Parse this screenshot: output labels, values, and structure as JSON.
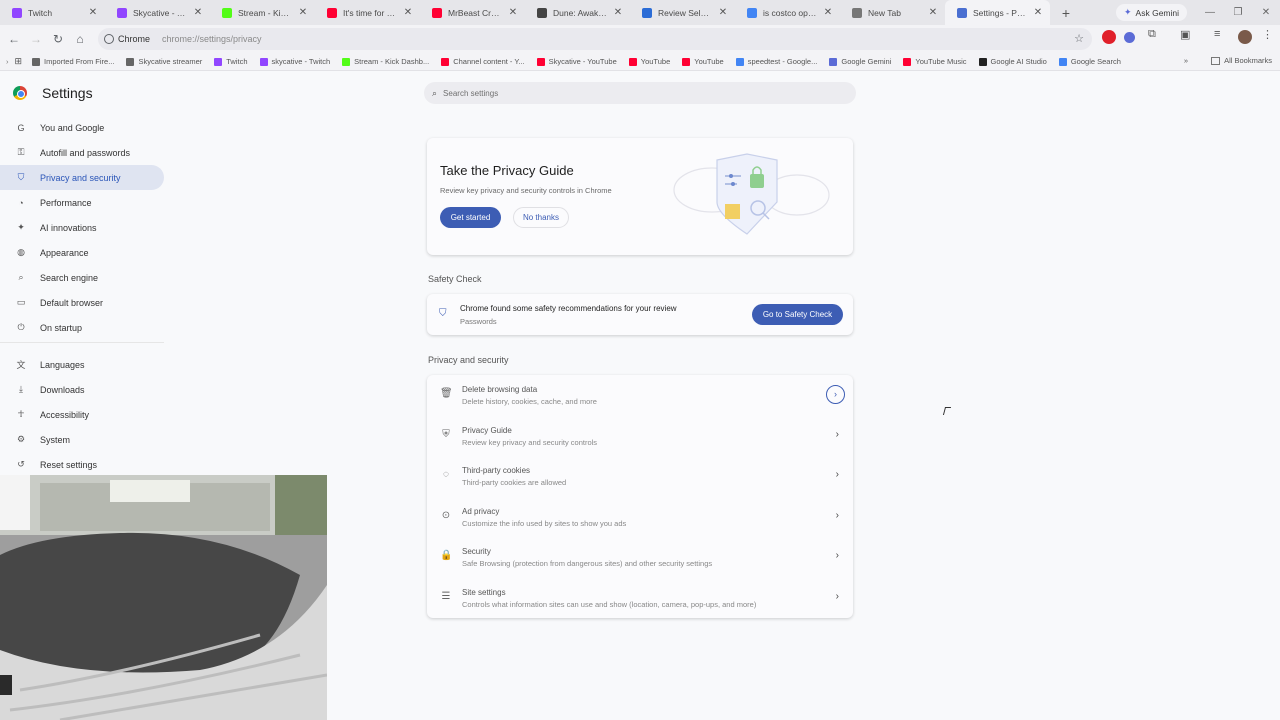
{
  "tabs": [
    {
      "title": "Twitch",
      "icon": "twitch-icon",
      "color": "#9146ff",
      "active": false
    },
    {
      "title": "Skycative - Twitch",
      "icon": "twitch-icon",
      "color": "#9146ff",
      "active": false
    },
    {
      "title": "Stream - Kick Das",
      "icon": "kick-icon",
      "color": "#53fc18",
      "active": false
    },
    {
      "title": "It's time for a big",
      "icon": "youtube-icon",
      "color": "#ff0033",
      "active": false
    },
    {
      "title": "MrBeast Crashout",
      "icon": "youtube-icon",
      "color": "#ff0033",
      "active": false
    },
    {
      "title": "Dune: Awakening",
      "icon": "game-icon",
      "color": "#444444",
      "active": false
    },
    {
      "title": "Review Selections",
      "icon": "doc-icon",
      "color": "#2b6cd6",
      "active": false
    },
    {
      "title": "is costco open on",
      "icon": "google-icon",
      "color": "#4285f4",
      "active": false
    },
    {
      "title": "New Tab",
      "icon": "chrome-icon",
      "color": "#777777",
      "active": false
    },
    {
      "title": "Settings - Privacy",
      "icon": "gear-icon",
      "color": "#4a6fd1",
      "active": true
    }
  ],
  "ask_gemini": "Ask Gemini",
  "omnibox": {
    "chip": "Chrome",
    "url": "chrome://settings/privacy"
  },
  "bookmarks": [
    {
      "label": "Imported From Fire...",
      "icon": "folder-icon",
      "color": "#666666"
    },
    {
      "label": "Skycative streamer",
      "icon": "stream-icon",
      "color": "#666666"
    },
    {
      "label": "Twitch",
      "icon": "twitch-icon",
      "color": "#9146ff"
    },
    {
      "label": "skycative - Twitch",
      "icon": "twitch-icon",
      "color": "#9146ff"
    },
    {
      "label": "Stream - Kick Dashb...",
      "icon": "kick-icon",
      "color": "#53fc18"
    },
    {
      "label": "Channel content - Y...",
      "icon": "youtube-icon",
      "color": "#ff0033"
    },
    {
      "label": "Skycative - YouTube",
      "icon": "youtube-icon",
      "color": "#ff0033"
    },
    {
      "label": "YouTube",
      "icon": "youtube-icon",
      "color": "#ff0033"
    },
    {
      "label": "YouTube",
      "icon": "youtube-icon",
      "color": "#ff0033"
    },
    {
      "label": "speedtest - Google...",
      "icon": "google-icon",
      "color": "#4285f4"
    },
    {
      "label": "Google Gemini",
      "icon": "gemini-icon",
      "color": "#5b6bd6"
    },
    {
      "label": "YouTube Music",
      "icon": "youtube-music-icon",
      "color": "#ff0033"
    },
    {
      "label": "Google AI Studio",
      "icon": "ai-studio-icon",
      "color": "#222222"
    },
    {
      "label": "Google Search",
      "icon": "google-icon",
      "color": "#4285f4"
    }
  ],
  "all_bookmarks": "All Bookmarks",
  "settings_title": "Settings",
  "search_placeholder": "Search settings",
  "nav": [
    {
      "label": "You and Google",
      "icon": "google-icon",
      "glyph": "G"
    },
    {
      "label": "Autofill and passwords",
      "icon": "key-icon",
      "glyph": "⚿"
    },
    {
      "label": "Privacy and security",
      "icon": "shield-icon",
      "glyph": "⛉",
      "active": true
    },
    {
      "label": "Performance",
      "icon": "speedometer-icon",
      "glyph": "◔"
    },
    {
      "label": "AI innovations",
      "icon": "sparkle-icon",
      "glyph": "✦"
    },
    {
      "label": "Appearance",
      "icon": "palette-icon",
      "glyph": "◍"
    },
    {
      "label": "Search engine",
      "icon": "search-icon",
      "glyph": "⌕"
    },
    {
      "label": "Default browser",
      "icon": "browser-icon",
      "glyph": "▭"
    },
    {
      "label": "On startup",
      "icon": "power-icon",
      "glyph": "⏻"
    }
  ],
  "nav2": [
    {
      "label": "Languages",
      "icon": "translate-icon",
      "glyph": "文"
    },
    {
      "label": "Downloads",
      "icon": "download-icon",
      "glyph": "⤓"
    },
    {
      "label": "Accessibility",
      "icon": "accessibility-icon",
      "glyph": "☥"
    },
    {
      "label": "System",
      "icon": "wrench-icon",
      "glyph": "⚙"
    },
    {
      "label": "Reset settings",
      "icon": "reset-icon",
      "glyph": "↺"
    }
  ],
  "privacy_guide": {
    "title": "Take the Privacy Guide",
    "subtitle": "Review key privacy and security controls in Chrome",
    "primary": "Get started",
    "secondary": "No thanks"
  },
  "safety_check": {
    "section": "Safety Check",
    "message": "Chrome found some safety recommendations for your review",
    "detail": "Passwords",
    "button": "Go to Safety Check"
  },
  "privacy_section": {
    "label": "Privacy and security",
    "rows": [
      {
        "title": "Delete browsing data",
        "subtitle": "Delete history, cookies, cache, and more",
        "icon": "trash-icon",
        "glyph": "🗑"
      },
      {
        "title": "Privacy Guide",
        "subtitle": "Review key privacy and security controls",
        "icon": "privacy-guide-icon",
        "glyph": "⛨"
      },
      {
        "title": "Third-party cookies",
        "subtitle": "Third-party cookies are allowed",
        "icon": "cookie-icon",
        "glyph": "◌"
      },
      {
        "title": "Ad privacy",
        "subtitle": "Customize the info used by sites to show you ads",
        "icon": "ad-privacy-icon",
        "glyph": "⊙"
      },
      {
        "title": "Security",
        "subtitle": "Safe Browsing (protection from dangerous sites) and other security settings",
        "icon": "lock-icon",
        "glyph": "🔒"
      },
      {
        "title": "Site settings",
        "subtitle": "Controls what information sites can use and show (location, camera, pop-ups, and more)",
        "icon": "tune-icon",
        "glyph": "☰"
      }
    ]
  },
  "colors": {
    "accent": "#3d5db4",
    "active_nav_bg": "#dfe4f1"
  }
}
